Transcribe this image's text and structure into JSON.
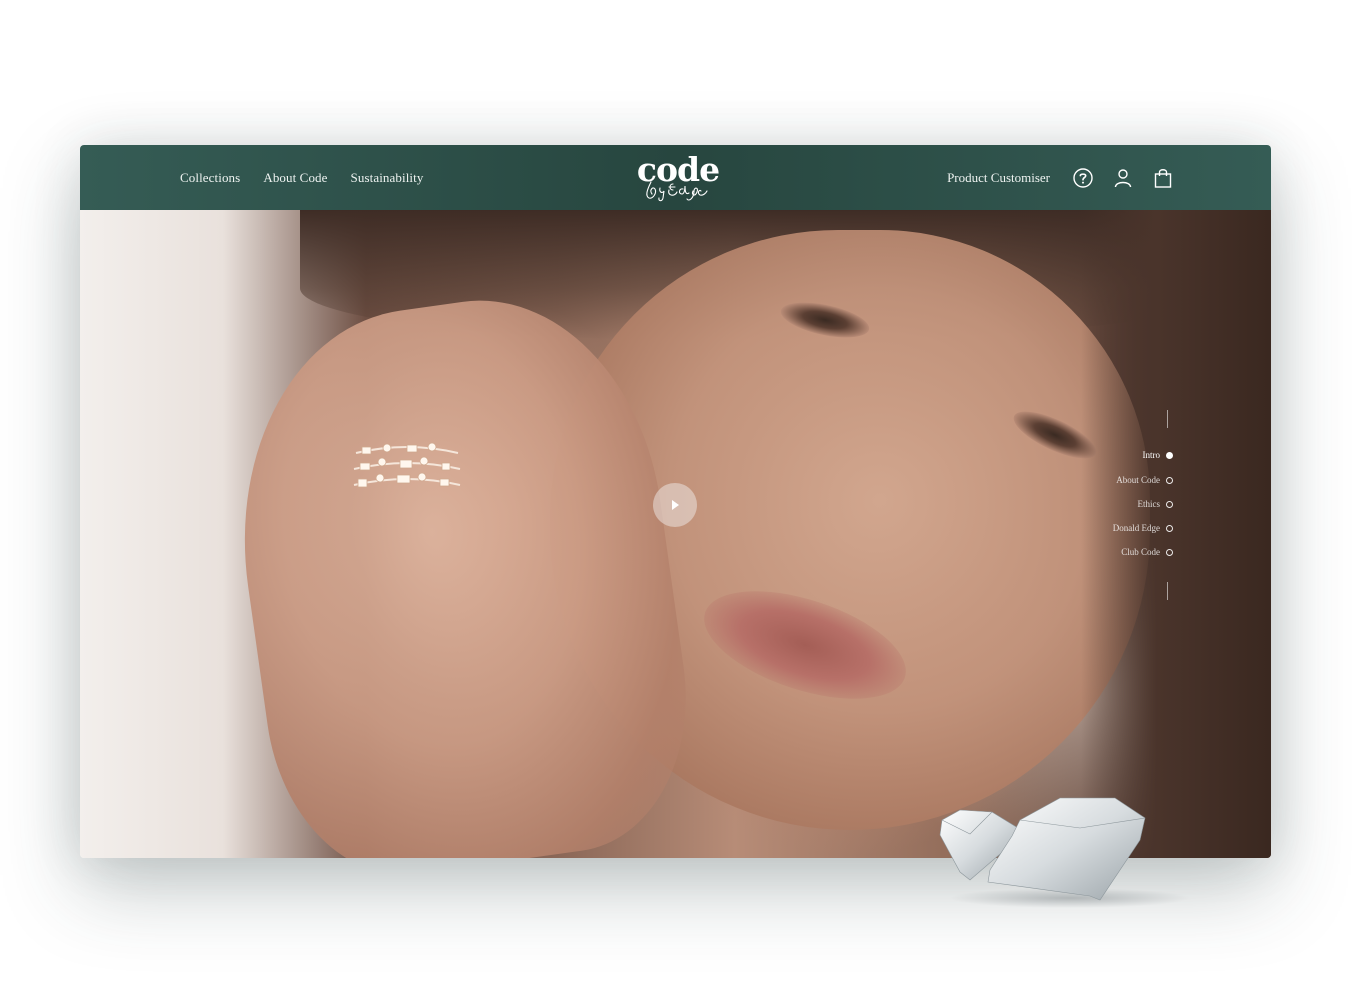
{
  "nav": {
    "links": [
      "Collections",
      "About Code",
      "Sustainability"
    ],
    "logo_main": "code",
    "logo_script": "by Edge",
    "customiser": "Product Customiser",
    "icons": [
      "help-icon",
      "user-icon",
      "bag-icon"
    ]
  },
  "hero": {
    "play_icon": "play-icon"
  },
  "section_nav": {
    "items": [
      {
        "label": "Intro",
        "active": true
      },
      {
        "label": "About Code",
        "active": false
      },
      {
        "label": "Ethics",
        "active": false
      },
      {
        "label": "Donald Edge",
        "active": false
      },
      {
        "label": "Club Code",
        "active": false
      }
    ]
  },
  "colors": {
    "navbar": "#27463f",
    "nav_text": "#eef3f1",
    "accent_white": "#ffffff"
  }
}
